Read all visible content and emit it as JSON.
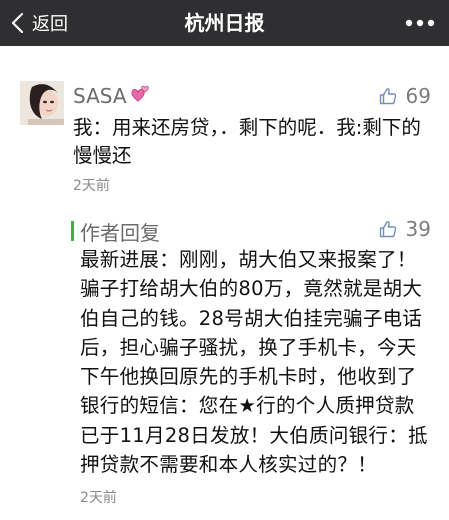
{
  "nav": {
    "back_label": "返回",
    "title": "杭州日报",
    "bg_color": "#2f2f32"
  },
  "comment": {
    "user": "SASA",
    "likes": "69",
    "text_lines": [
      "我：用来还房贷，．剩下的呢．我:剩下的",
      "慢慢还"
    ],
    "time": "2天前"
  },
  "reply": {
    "author_label": "作者回复",
    "accent_color": "#3cb34a",
    "likes": "39",
    "text_lines": [
      "最新进展：刚刚，胡大伯又来报案了！",
      "骗子打给胡大伯的80万，竟然就是胡大",
      "伯自己的钱。28号胡大伯挂完骗子电话",
      "后，担心骗子骚扰，换了手机卡，今天",
      "下午他换回原先的手机卡时，他收到了",
      "银行的短信：您在★行的个人质押贷款",
      "已于11月28日发放！大伯质问银行：抵",
      "押贷款不需要和本人核实过的？！"
    ],
    "time": "2天前"
  }
}
